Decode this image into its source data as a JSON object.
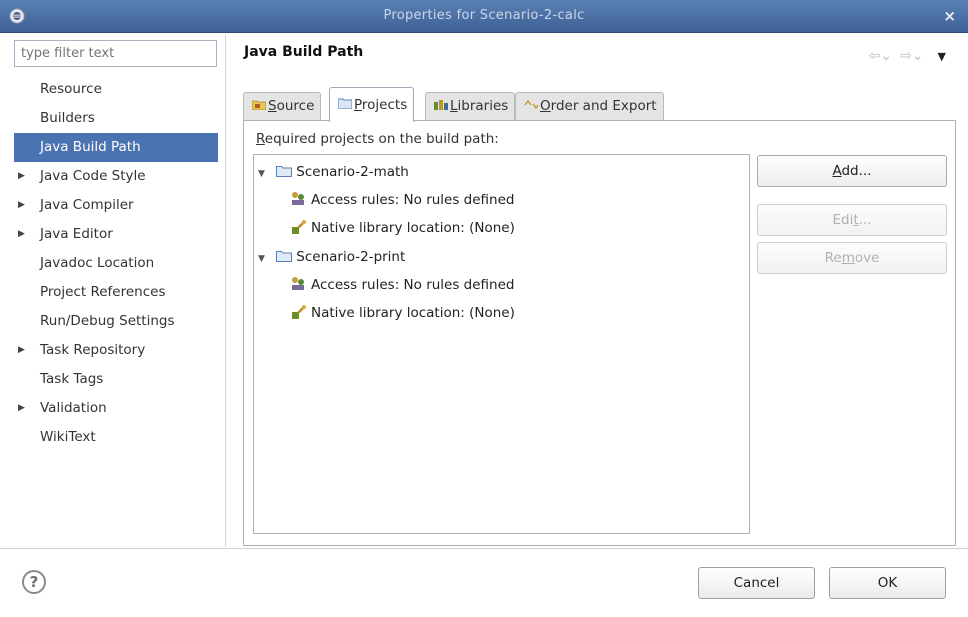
{
  "window": {
    "title": "Properties for Scenario-2-calc",
    "close_glyph": "×",
    "app_icon": "eclipse-icon"
  },
  "filter": {
    "placeholder": "type filter text",
    "value": ""
  },
  "nav": {
    "items": [
      {
        "label": "Resource",
        "expandable": false,
        "selected": false
      },
      {
        "label": "Builders",
        "expandable": false,
        "selected": false
      },
      {
        "label": "Java Build Path",
        "expandable": false,
        "selected": true
      },
      {
        "label": "Java Code Style",
        "expandable": true,
        "selected": false
      },
      {
        "label": "Java Compiler",
        "expandable": true,
        "selected": false
      },
      {
        "label": "Java Editor",
        "expandable": true,
        "selected": false
      },
      {
        "label": "Javadoc Location",
        "expandable": false,
        "selected": false
      },
      {
        "label": "Project References",
        "expandable": false,
        "selected": false
      },
      {
        "label": "Run/Debug Settings",
        "expandable": false,
        "selected": false
      },
      {
        "label": "Task Repository",
        "expandable": true,
        "selected": false
      },
      {
        "label": "Task Tags",
        "expandable": false,
        "selected": false
      },
      {
        "label": "Validation",
        "expandable": true,
        "selected": false
      },
      {
        "label": "WikiText",
        "expandable": false,
        "selected": false
      }
    ]
  },
  "page": {
    "title": "Java Build Path",
    "back_icon": "back-arrow-icon",
    "forward_icon": "forward-arrow-icon",
    "menu_icon": "view-menu-icon"
  },
  "tabs": [
    {
      "label": "Source",
      "mnemonic": "S",
      "rest": "ource",
      "icon": "source-folder-icon",
      "active": false
    },
    {
      "label": "Projects",
      "mnemonic": "P",
      "rest": "rojects",
      "icon": "project-folder-icon",
      "active": true
    },
    {
      "label": "Libraries",
      "mnemonic": "L",
      "rest": "ibraries",
      "icon": "library-icon",
      "active": false
    },
    {
      "label": "Order and Export",
      "mnemonic": "O",
      "rest": "rder and Export",
      "icon": "order-icon",
      "active": false
    }
  ],
  "projects": {
    "heading_mnemonic": "R",
    "heading_rest": "equired projects on the build path:",
    "entries": [
      {
        "name": "Scenario-2-math",
        "access_rules": "Access rules: No rules defined",
        "native_lib": "Native library location: (None)"
      },
      {
        "name": "Scenario-2-print",
        "access_rules": "Access rules: No rules defined",
        "native_lib": "Native library location: (None)"
      }
    ]
  },
  "buttons": {
    "add": {
      "pre": "",
      "mnemonic": "A",
      "post": "dd...",
      "enabled": true
    },
    "edit": {
      "pre": "Edi",
      "mnemonic": "t",
      "post": "...",
      "enabled": false
    },
    "remove": {
      "pre": "Re",
      "mnemonic": "m",
      "post": "ove",
      "enabled": false
    },
    "cancel": "Cancel",
    "ok": "OK",
    "help": "?"
  },
  "colors": {
    "titlebar": "#4a6fa5",
    "selection": "#4a73b2"
  }
}
